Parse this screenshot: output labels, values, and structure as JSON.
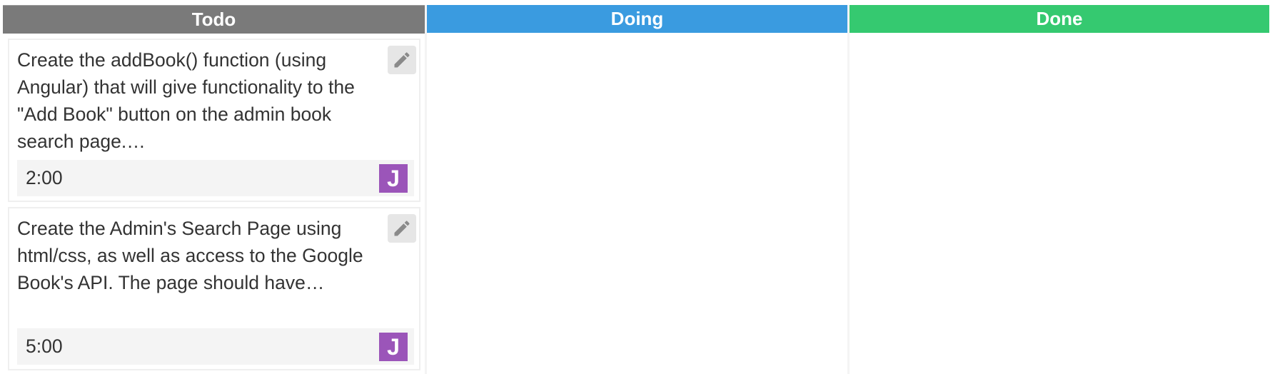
{
  "columns": [
    {
      "title": "Todo",
      "color": "#7a7a7a",
      "cards": [
        {
          "text": "Create the addBook() function (using Angular) that will give functionality to the \"Add Book\" button on the admin book search page.…",
          "time": "2:00",
          "assignee_initial": "J",
          "assignee_color": "#9b55b9",
          "edit_icon": "pencil-icon"
        },
        {
          "text": "Create the Admin's Search Page using html/css, as well as access to the Google Book's API. The page should have…",
          "time": "5:00",
          "assignee_initial": "J",
          "assignee_color": "#9b55b9",
          "edit_icon": "pencil-icon"
        }
      ]
    },
    {
      "title": "Doing",
      "color": "#3a9be0",
      "cards": []
    },
    {
      "title": "Done",
      "color": "#35c970",
      "cards": []
    }
  ]
}
